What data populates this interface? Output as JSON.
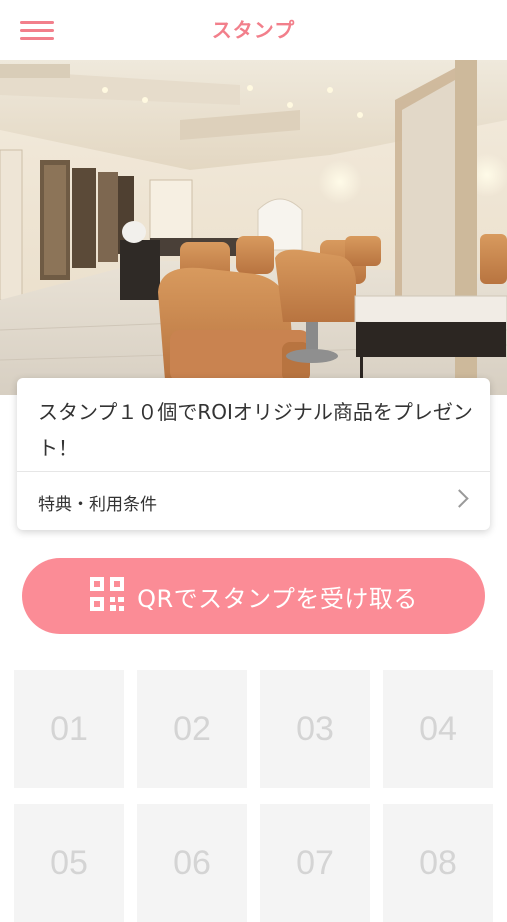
{
  "header": {
    "title": "スタンプ",
    "menu_icon": "hamburger-menu-icon",
    "accent_color": "#f27f8b"
  },
  "hero": {
    "image": "salon-interior-photo"
  },
  "card": {
    "title": "スタンプ１０個でROIオリジナル商品をプレゼント！",
    "link_label": "特典・利用条件",
    "link_icon": "chevron-right-icon"
  },
  "qr_button": {
    "label": "QRでスタンプを受け取る",
    "icon": "qr-code-icon",
    "color": "#fb8c96"
  },
  "stamps": [
    "01",
    "02",
    "03",
    "04",
    "05",
    "06",
    "07",
    "08"
  ]
}
